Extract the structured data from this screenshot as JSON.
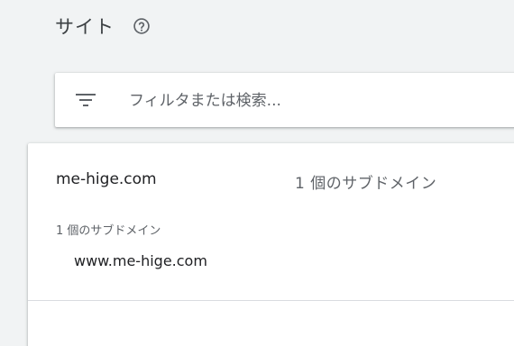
{
  "header": {
    "title": "サイト",
    "help_icon": "help-circle-icon"
  },
  "filter": {
    "icon": "filter-list-icon",
    "placeholder": "フィルタまたは検索...",
    "value": ""
  },
  "property": {
    "domain": "me-hige.com",
    "subdomain_summary": "1 個のサブドメイン",
    "subdomain_heading": "1 個のサブドメイン",
    "subdomains": [
      "www.me-hige.com"
    ]
  },
  "colors": {
    "background": "#f1f3f4",
    "card": "#ffffff",
    "text_primary": "#202124",
    "text_secondary": "#5f6368",
    "divider": "#dadce0"
  }
}
